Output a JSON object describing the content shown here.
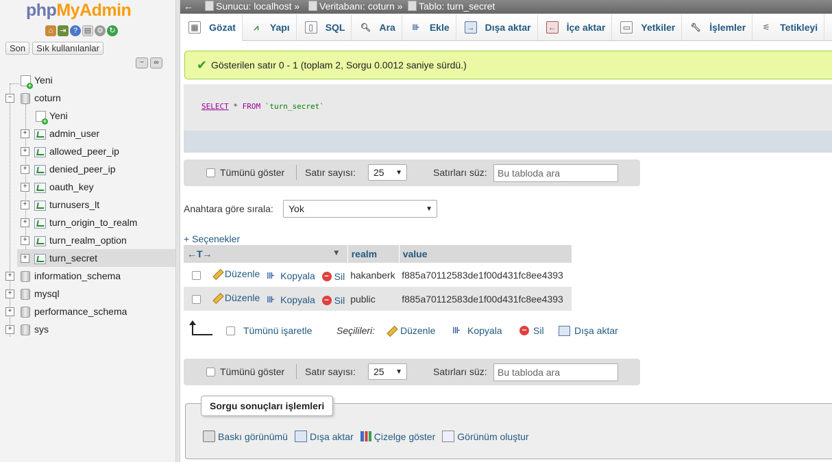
{
  "nav": {
    "logo_php": "php",
    "logo_myadmin": "MyAdmin",
    "icons": [
      "home-icon",
      "exit-icon",
      "help-icon",
      "docs-icon",
      "settings-icon",
      "reload-icon"
    ],
    "recent_buttons": [
      "Son",
      "Sık kullanılanlar"
    ],
    "tree": {
      "new_top": "Yeni",
      "db_coturn": "coturn",
      "new_coturn": "Yeni",
      "tables": [
        "admin_user",
        "allowed_peer_ip",
        "denied_peer_ip",
        "oauth_key",
        "turnusers_lt",
        "turn_origin_to_realm",
        "turn_realm_option",
        "turn_secret"
      ],
      "other_dbs": [
        "information_schema",
        "mysql",
        "performance_schema",
        "sys"
      ]
    }
  },
  "topbar": {
    "back": "←",
    "server": "Sunucu: localhost",
    "database": "Veritabanı: coturn",
    "table": "Tablo: turn_secret",
    "sep": "»"
  },
  "tabs": [
    "Gözat",
    "Yapı",
    "SQL",
    "Ara",
    "Ekle",
    "Dışa aktar",
    "İçe aktar",
    "Yetkiler",
    "İşlemler",
    "Tetikleyi"
  ],
  "notice": "Gösterilen satır 0 - 1 (toplam 2, Sorgu 0.0012 saniye sürdü.)",
  "sql": {
    "select": "SELECT",
    "star": " * ",
    "from": "FROM",
    "table": " `turn_secret`"
  },
  "navbar": {
    "show_all": "Tümünü göster",
    "row_count_label": "Satır sayısı:",
    "row_count": "25",
    "filter_label": "Satırları süz:",
    "filter_placeholder": "Bu tabloda ara"
  },
  "sort": {
    "label": "Anahtara göre sırala:",
    "value": "Yok"
  },
  "options_link": "+ Seçenekler",
  "table": {
    "resize_glyph": "←T→",
    "headers": [
      "realm",
      "value"
    ],
    "actions": {
      "edit": "Düzenle",
      "copy": "Kopyala",
      "delete": "Sil"
    },
    "rows": [
      {
        "realm": "hakanberk",
        "value": "f885a70112583de1f00d431fc8ee4393"
      },
      {
        "realm": "public",
        "value": "f885a70112583de1f00d431fc8ee4393"
      }
    ]
  },
  "bulk": {
    "check_all": "Tümünü işaretle",
    "selected": "Seçilileri:",
    "edit": "Düzenle",
    "copy": "Kopyala",
    "delete": "Sil",
    "export": "Dışa aktar"
  },
  "query_ops": {
    "legend": "Sorgu sonuçları işlemleri",
    "print": "Baskı görünümü",
    "export": "Dışa aktar",
    "chart": "Çizelge göster",
    "view": "Görünüm oluştur"
  }
}
